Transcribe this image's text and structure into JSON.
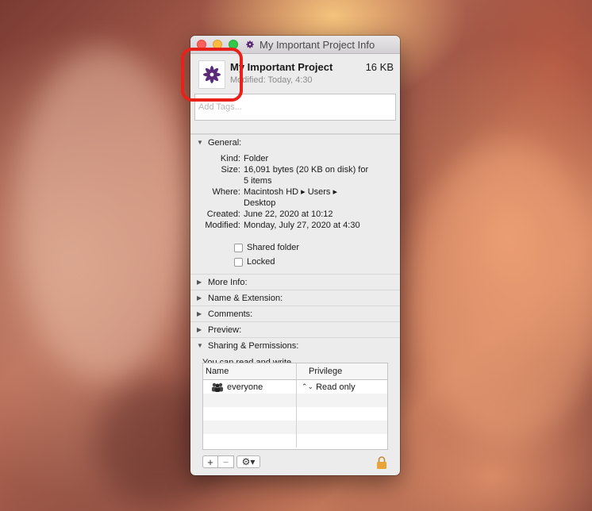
{
  "window": {
    "title": "My Important Project Info"
  },
  "header": {
    "name": "My Important Project",
    "size": "16 KB",
    "modified": "Modified: Today, 4:30",
    "tags_placeholder": "Add Tags..."
  },
  "sections": {
    "general": "General:",
    "more_info": "More Info:",
    "name_extension": "Name & Extension:",
    "comments": "Comments:",
    "preview": "Preview:",
    "sharing": "Sharing & Permissions:"
  },
  "general": {
    "kind_label": "Kind:",
    "kind_value": "Folder",
    "size_label": "Size:",
    "size_value_1": "16,091 bytes (20 KB on disk) for",
    "size_value_2": "5 items",
    "where_label": "Where:",
    "where_value_1": "Macintosh HD ▸ Users ▸",
    "where_value_2": "Desktop",
    "created_label": "Created:",
    "created_value": "June 22, 2020 at 10:12",
    "modified_label": "Modified:",
    "modified_value": "Monday, July 27, 2020 at 4:30",
    "shared_folder": "Shared folder",
    "locked": "Locked"
  },
  "sharing": {
    "status": "You can read and write",
    "columns": {
      "name": "Name",
      "privilege": "Privilege"
    },
    "rows": [
      {
        "name": "everyone",
        "privilege": "Read only"
      }
    ],
    "add_button": "+",
    "remove_button": "−",
    "gear_button": "⚙▾"
  },
  "colors": {
    "icon_purple": "#5b2a7a",
    "highlight_red": "#e8221a",
    "lock_gold": "#e8a33a"
  }
}
